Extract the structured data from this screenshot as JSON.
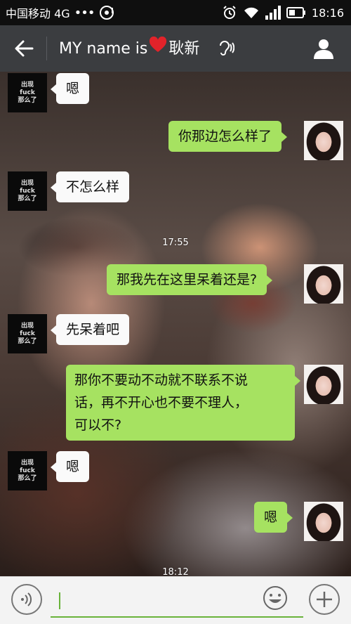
{
  "status_bar": {
    "carrier": "中国移动 4G",
    "dots": "•••",
    "time": "18:16"
  },
  "header": {
    "title_prefix": "MY name is",
    "title_suffix": "耿新",
    "icons": [
      "back-arrow-icon",
      "heart-icon",
      "earpiece-icon",
      "profile-icon"
    ]
  },
  "avatars": {
    "contact_label_lines": [
      "出现",
      "fuck",
      "那么了"
    ]
  },
  "messages": [
    {
      "side": "left",
      "text": "嗯"
    },
    {
      "side": "right",
      "text": "你那边怎么样了"
    },
    {
      "side": "left",
      "text": "不怎么样"
    },
    {
      "type": "time",
      "text": "17:55"
    },
    {
      "side": "right",
      "text": "那我先在这里呆着还是?"
    },
    {
      "side": "left",
      "text": "先呆着吧"
    },
    {
      "side": "right",
      "lines": [
        "那你不要动不动就不联系不说",
        "话，再不开心也不要不理人，",
        "可以不?"
      ]
    },
    {
      "side": "left",
      "text": "嗯"
    },
    {
      "side": "right",
      "text": "嗯"
    },
    {
      "type": "time",
      "text": "18:12"
    }
  ],
  "input_bar": {
    "value": "",
    "icons": [
      "voice-icon",
      "emoji-icon",
      "plus-icon"
    ]
  },
  "colors": {
    "sent_bubble": "#a6e261",
    "received_bubble": "#fafafa",
    "title_bar": "#3b3d40",
    "accent": "#69b33a"
  }
}
